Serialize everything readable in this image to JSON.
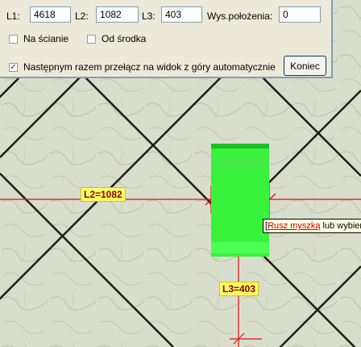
{
  "toolbar": {
    "l1_label": "L1:",
    "l1_value": "4618",
    "l2_label": "L2:",
    "l2_value": "1082",
    "l3_label": "L3:",
    "l3_value": "403",
    "height_label": "Wys.położenia:",
    "height_value": "0",
    "on_wall_label": "Na ścianie",
    "on_wall_checked": false,
    "from_center_label": "Od środka",
    "from_center_checked": false,
    "auto_switch_label": "Następnym  razem przełącz na widok z góry automatycznie",
    "auto_switch_checked": true,
    "end_button_label": "Koniec"
  },
  "canvas": {
    "l2_dimension": "L2=1082",
    "l3_dimension": "L3=403",
    "tooltip_bracket": "[",
    "tooltip_action": "Rusz myszką",
    "tooltip_rest": " lub wybierz"
  },
  "colors": {
    "tile_lines": "#1b1b1b",
    "dimension_lines": "#e01010",
    "object_fill": "#39f23c",
    "label_bg": "#ffff66"
  }
}
